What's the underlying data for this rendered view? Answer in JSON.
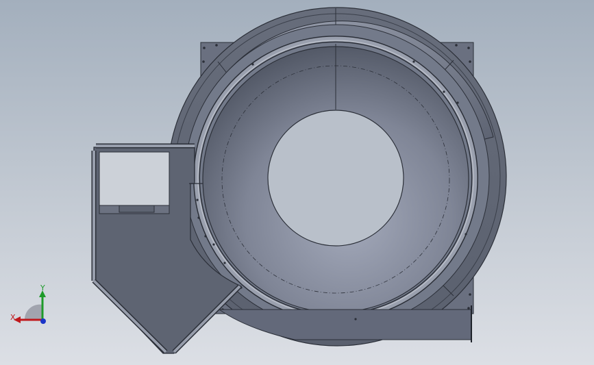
{
  "viewport": {
    "background_top": "#a3afbd",
    "background_bottom": "#dcdfe5"
  },
  "model": {
    "face_color": "#6f7584",
    "edge_color": "#2b2f38"
  },
  "triad": {
    "x_label": "X",
    "y_label": "Y",
    "x_color": "#c0181c",
    "y_color": "#1e9a2a",
    "z_color": "#1a35c8"
  }
}
